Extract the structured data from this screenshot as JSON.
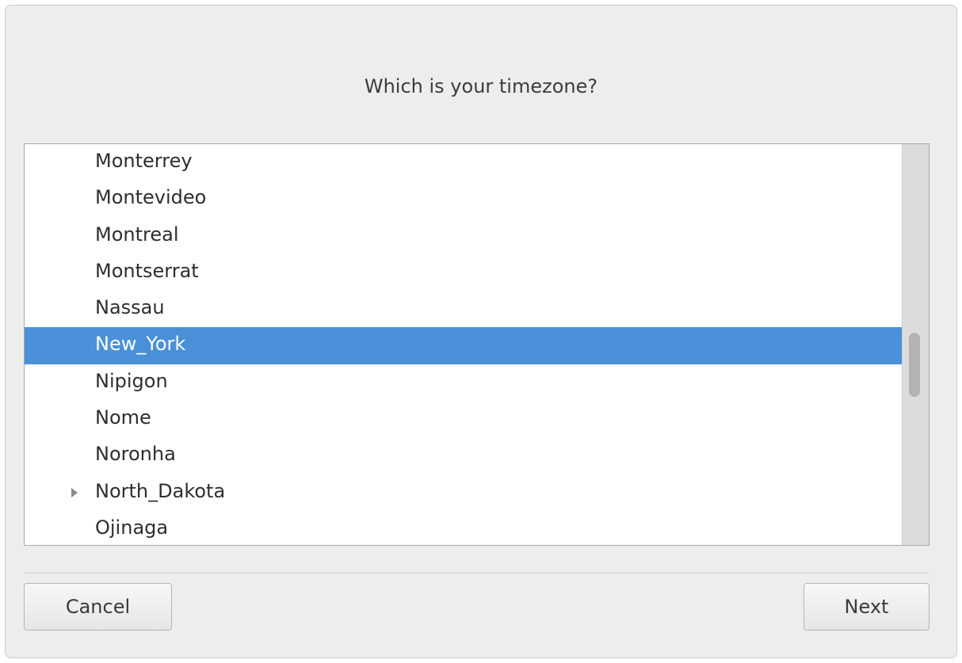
{
  "dialog": {
    "title": "Which is your timezone?"
  },
  "timezone_list": {
    "items": [
      {
        "label": "Monterrey",
        "selected": false,
        "expandable": false
      },
      {
        "label": "Montevideo",
        "selected": false,
        "expandable": false
      },
      {
        "label": "Montreal",
        "selected": false,
        "expandable": false
      },
      {
        "label": "Montserrat",
        "selected": false,
        "expandable": false
      },
      {
        "label": "Nassau",
        "selected": false,
        "expandable": false
      },
      {
        "label": "New_York",
        "selected": true,
        "expandable": false
      },
      {
        "label": "Nipigon",
        "selected": false,
        "expandable": false
      },
      {
        "label": "Nome",
        "selected": false,
        "expandable": false
      },
      {
        "label": "Noronha",
        "selected": false,
        "expandable": false
      },
      {
        "label": "North_Dakota",
        "selected": false,
        "expandable": true
      },
      {
        "label": "Ojinaga",
        "selected": false,
        "expandable": false
      }
    ],
    "scroll_position": 0.56,
    "visible_fraction": 0.16
  },
  "buttons": {
    "cancel_label": "Cancel",
    "next_label": "Next"
  },
  "colors": {
    "selection": "#4a90d9",
    "window_bg": "#ededed"
  }
}
